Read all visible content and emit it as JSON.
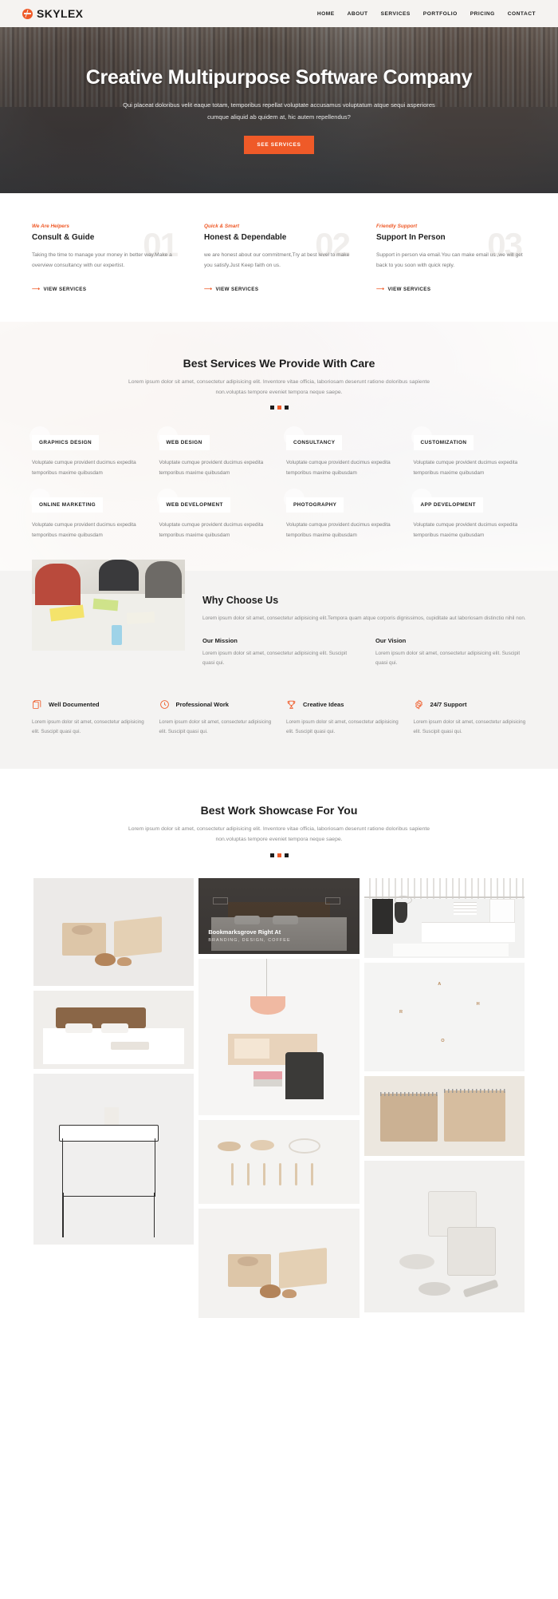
{
  "header": {
    "logo_text": "SKYLEX",
    "nav": [
      {
        "label": "HOME"
      },
      {
        "label": "ABOUT"
      },
      {
        "label": "SERVICES"
      },
      {
        "label": "PORTFOLIO"
      },
      {
        "label": "PRICING"
      },
      {
        "label": "CONTACT"
      }
    ]
  },
  "hero": {
    "title": "Creative Multipurpose Software Company",
    "subtitle": "Qui placeat doloribus velit eaque totam, temporibus repellat voluptate accusamus voluptatum atque sequi asperiores cumque aliquid ab quidem at, hic autem repellendus?",
    "button": "SEE SERVICES"
  },
  "features": [
    {
      "number": "01",
      "kicker": "We Are Helpers",
      "title": "Consult & Guide",
      "text": "Taking the time to manage your money in better way.Make a overview consultancy with our expertist.",
      "link": "VIEW SERVICES"
    },
    {
      "number": "02",
      "kicker": "Quick & Smart",
      "title": "Honest & Dependable",
      "text": "we are honest about our commitment,Try at best level to make you satisfy.Just Keep faith on us.",
      "link": "VIEW SERVICES"
    },
    {
      "number": "03",
      "kicker": "Friendly Support",
      "title": "Support In Person",
      "text": "Support in person via email.You can make email us ,we will get back to you soon with quick reply.",
      "link": "VIEW SERVICES"
    }
  ],
  "services": {
    "title": "Best Services We Provide With Care",
    "subtitle": "Lorem ipsum dolor sit amet, consectetur adipisicing elit. Inventore vitae officia, laboriosam deserunt ratione doloribus sapiente non.voluptas tempore eveniet tempora neque saepe.",
    "body": "Voluptate cumque provident ducimus expedita temporibus maxime quibusdam",
    "items": [
      {
        "title": "GRAPHICS DESIGN"
      },
      {
        "title": "WEB DESIGN"
      },
      {
        "title": "CONSULTANCY"
      },
      {
        "title": "CUSTOMIZATION"
      },
      {
        "title": "ONLINE MARKETING"
      },
      {
        "title": "WEB DEVELOPMENT"
      },
      {
        "title": "PHOTOGRAPHY"
      },
      {
        "title": "APP DEVELOPMENT"
      }
    ]
  },
  "why": {
    "title": "Why Choose Us",
    "text": "Lorem ipsum dolor sit amet, consectetur adipisicing elit.Tempora quam atque corporis dignissimos, cupiditate aut laboriosam distinctio nihil non.",
    "mission_title": "Our Mission",
    "mission_text": "Lorem ipsum dolor sit amet, consectetur adipisicing elit. Suscipit quasi qui.",
    "vision_title": "Our Vision",
    "vision_text": "Lorem ipsum dolor sit amet, consectetur adipisicing elit. Suscipit quasi qui.",
    "perks": [
      {
        "icon": "documents-icon",
        "title": "Well Documented",
        "text": "Lorem ipsum dolor sit amet, consectetur adipisicing elit. Suscipit quasi qui."
      },
      {
        "icon": "clock-icon",
        "title": "Professional Work",
        "text": "Lorem ipsum dolor sit amet, consectetur adipisicing elit. Suscipit quasi qui."
      },
      {
        "icon": "trophy-icon",
        "title": "Creative Ideas",
        "text": "Lorem ipsum dolor sit amet, consectetur adipisicing elit. Suscipit quasi qui."
      },
      {
        "icon": "gear-icon",
        "title": "24/7 Support",
        "text": "Lorem ipsum dolor sit amet, consectetur adipisicing elit. Suscipit quasi qui."
      }
    ]
  },
  "portfolio": {
    "title": "Best Work Showcase For You",
    "subtitle": "Lorem ipsum dolor sit amet, consectetur adipisicing elit. Inventore vitae officia, laboriosam deserunt ratione doloribus sapiente non.voluptas tempore eveniet tempora neque saepe.",
    "featured_caption_title": "Bookmarksgrove Right At",
    "featured_caption_tags": "BRANDING, DESIGN, COFFEE",
    "letters": [
      "A",
      "H",
      "R",
      "O"
    ]
  },
  "colors": {
    "accent": "#ef5a28",
    "dark": "#1d1d1d",
    "muted": "#8a8a8a"
  }
}
